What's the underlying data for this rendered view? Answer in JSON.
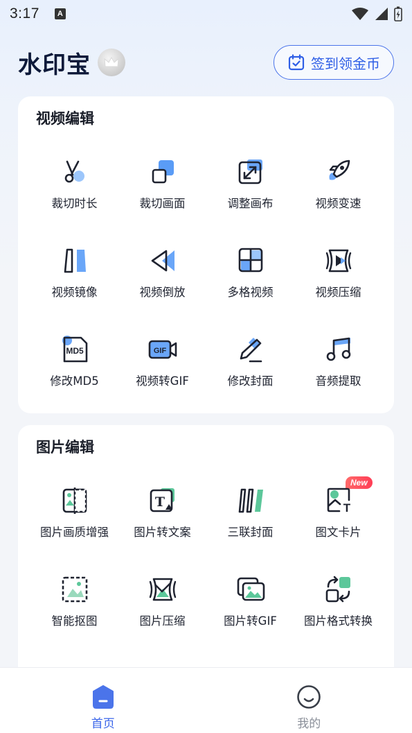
{
  "status_bar": {
    "time": "3:17",
    "notif_letter": "A"
  },
  "header": {
    "app_title": "水印宝",
    "checkin_label": "签到领金币"
  },
  "colors": {
    "accent": "#3b66ea",
    "icon_dark": "#1f2330",
    "icon_blue": "#6aa6f8",
    "icon_green": "#5cc79a",
    "badge_red": "#ff4a5c"
  },
  "video_section": {
    "title": "视频编辑",
    "tools": [
      {
        "label": "裁切时长",
        "icon": "scissors-icon"
      },
      {
        "label": "裁切画面",
        "icon": "crop-frame-icon"
      },
      {
        "label": "调整画布",
        "icon": "canvas-resize-icon"
      },
      {
        "label": "视频变速",
        "icon": "rocket-icon"
      },
      {
        "label": "视频镜像",
        "icon": "mirror-icon"
      },
      {
        "label": "视频倒放",
        "icon": "rewind-icon"
      },
      {
        "label": "多格视频",
        "icon": "grid-video-icon"
      },
      {
        "label": "视频压缩",
        "icon": "video-compress-icon"
      },
      {
        "label": "修改MD5",
        "icon": "md5-icon",
        "icon_text": "MD5"
      },
      {
        "label": "视频转GIF",
        "icon": "video-gif-icon",
        "icon_text": "GIF"
      },
      {
        "label": "修改封面",
        "icon": "pencil-icon"
      },
      {
        "label": "音频提取",
        "icon": "music-note-icon"
      }
    ]
  },
  "image_section": {
    "title": "图片编辑",
    "tools": [
      {
        "label": "图片画质增强",
        "icon": "image-enhance-icon"
      },
      {
        "label": "图片转文案",
        "icon": "image-to-text-icon",
        "icon_text": "T"
      },
      {
        "label": "三联封面",
        "icon": "triptych-icon"
      },
      {
        "label": "图文卡片",
        "icon": "text-card-icon",
        "badge": "New",
        "icon_text": "T"
      },
      {
        "label": "智能抠图",
        "icon": "smart-cutout-icon"
      },
      {
        "label": "图片压缩",
        "icon": "image-compress-icon"
      },
      {
        "label": "图片转GIF",
        "icon": "image-gif-icon"
      },
      {
        "label": "图片格式转换",
        "icon": "format-convert-icon"
      }
    ]
  },
  "bottom_nav": {
    "items": [
      {
        "label": "首页",
        "icon": "home-icon",
        "active": true
      },
      {
        "label": "我的",
        "icon": "profile-icon",
        "active": false
      }
    ]
  }
}
